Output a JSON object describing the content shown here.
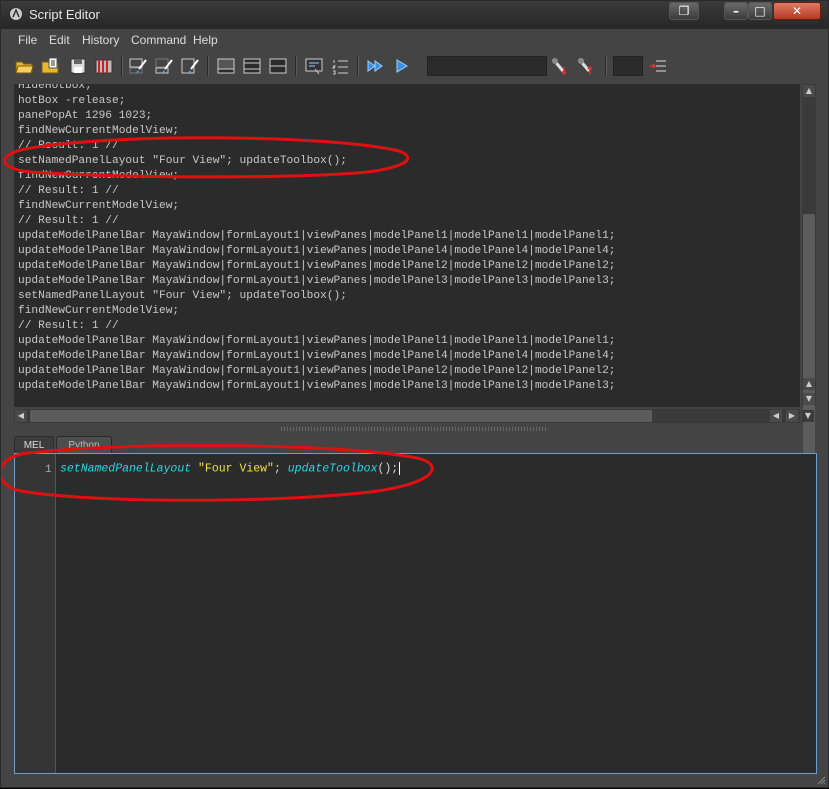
{
  "window": {
    "title": "Script Editor",
    "buttons": [
      "restore-down",
      "minimize",
      "maximize",
      "close"
    ]
  },
  "menu": {
    "items": [
      "File",
      "Edit",
      "History",
      "Command",
      "Help"
    ]
  },
  "toolbar": {
    "icons": [
      "open-script-icon",
      "source-script-icon",
      "save-script-icon",
      "save-to-shelf-icon",
      "clear-history-icon",
      "clear-input-icon",
      "clear-all-icon",
      "show-history-only-icon",
      "show-input-only-icon",
      "show-both-icon",
      "echo-all-commands-icon",
      "show-line-numbers-icon",
      "execute-all-icon",
      "execute-icon",
      "search-prev-icon",
      "search-next-icon",
      "goto-line-icon"
    ]
  },
  "history": {
    "lines": [
      "HideHotbox;",
      "hotBox -release;",
      "panePopAt 1296 1023;",
      "findNewCurrentModelView;",
      "// Result: 1 //",
      "setNamedPanelLayout \"Four View\"; updateToolbox();",
      "findNewCurrentModelView;",
      "// Result: 1 //",
      "findNewCurrentModelView;",
      "// Result: 1 //",
      "updateModelPanelBar MayaWindow|formLayout1|viewPanes|modelPanel1|modelPanel1|modelPanel1;",
      "updateModelPanelBar MayaWindow|formLayout1|viewPanes|modelPanel4|modelPanel4|modelPanel4;",
      "updateModelPanelBar MayaWindow|formLayout1|viewPanes|modelPanel2|modelPanel2|modelPanel2;",
      "updateModelPanelBar MayaWindow|formLayout1|viewPanes|modelPanel3|modelPanel3|modelPanel3;",
      "setNamedPanelLayout \"Four View\"; updateToolbox();",
      "findNewCurrentModelView;",
      "// Result: 1 //",
      "updateModelPanelBar MayaWindow|formLayout1|viewPanes|modelPanel1|modelPanel1|modelPanel1;",
      "updateModelPanelBar MayaWindow|formLayout1|viewPanes|modelPanel4|modelPanel4|modelPanel4;",
      "updateModelPanelBar MayaWindow|formLayout1|viewPanes|modelPanel2|modelPanel2|modelPanel2;",
      "updateModelPanelBar MayaWindow|formLayout1|viewPanes|modelPanel3|modelPanel3|modelPanel3;"
    ]
  },
  "tabs": [
    "MEL",
    "Python"
  ],
  "input": {
    "line_number": "1",
    "tokens": [
      {
        "text": "setNamedPanelLayout",
        "kind": "keyword"
      },
      {
        "text": " ",
        "kind": "plain"
      },
      {
        "text": "\"Four View\"",
        "kind": "string"
      },
      {
        "text": "; ",
        "kind": "plain"
      },
      {
        "text": "updateToolbox",
        "kind": "keyword"
      },
      {
        "text": "();",
        "kind": "plain"
      }
    ]
  },
  "colors": {
    "annotation": "#e01010",
    "keyword": "#20d8e8",
    "string": "#f0e040"
  }
}
